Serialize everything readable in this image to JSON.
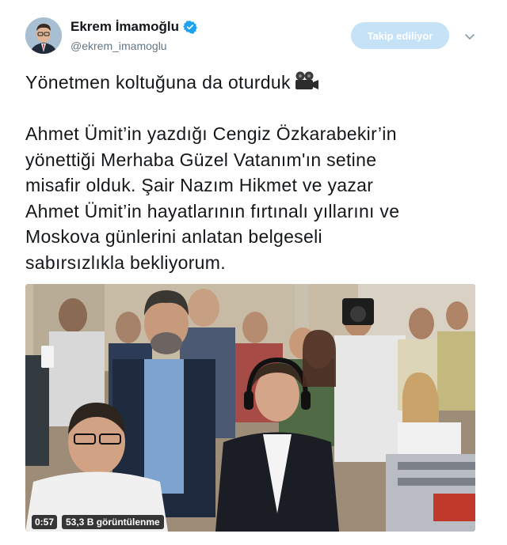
{
  "author": {
    "display_name": "Ekrem İmamoğlu",
    "handle": "@ekrem_imamoglu",
    "verified": true
  },
  "follow_button": {
    "label": "Takip ediliyor"
  },
  "tweet": {
    "text_line1": "Yönetmen koltuğuna da oturduk",
    "text_body": "Ahmet Ümit’in yazdığı Cengiz Özkarabekir’in\nyönettiği Merhaba Güzel Vatanım'ın setine\nmisafir olduk. Şair Nazım Hikmet ve yazar\nAhmet Ümit’in hayatlarının fırtınalı yıllarını ve\nMoskova günlerini anlatan belgeseli\nsabırsızlıkla bekliyorum.",
    "emoji": "movie-camera-icon"
  },
  "media": {
    "duration": "0:57",
    "views": "53,3 B görüntülenme"
  },
  "colors": {
    "accent": "#1da1f2",
    "follow_bg": "#c6e2f7",
    "secondary_text": "#657786"
  }
}
